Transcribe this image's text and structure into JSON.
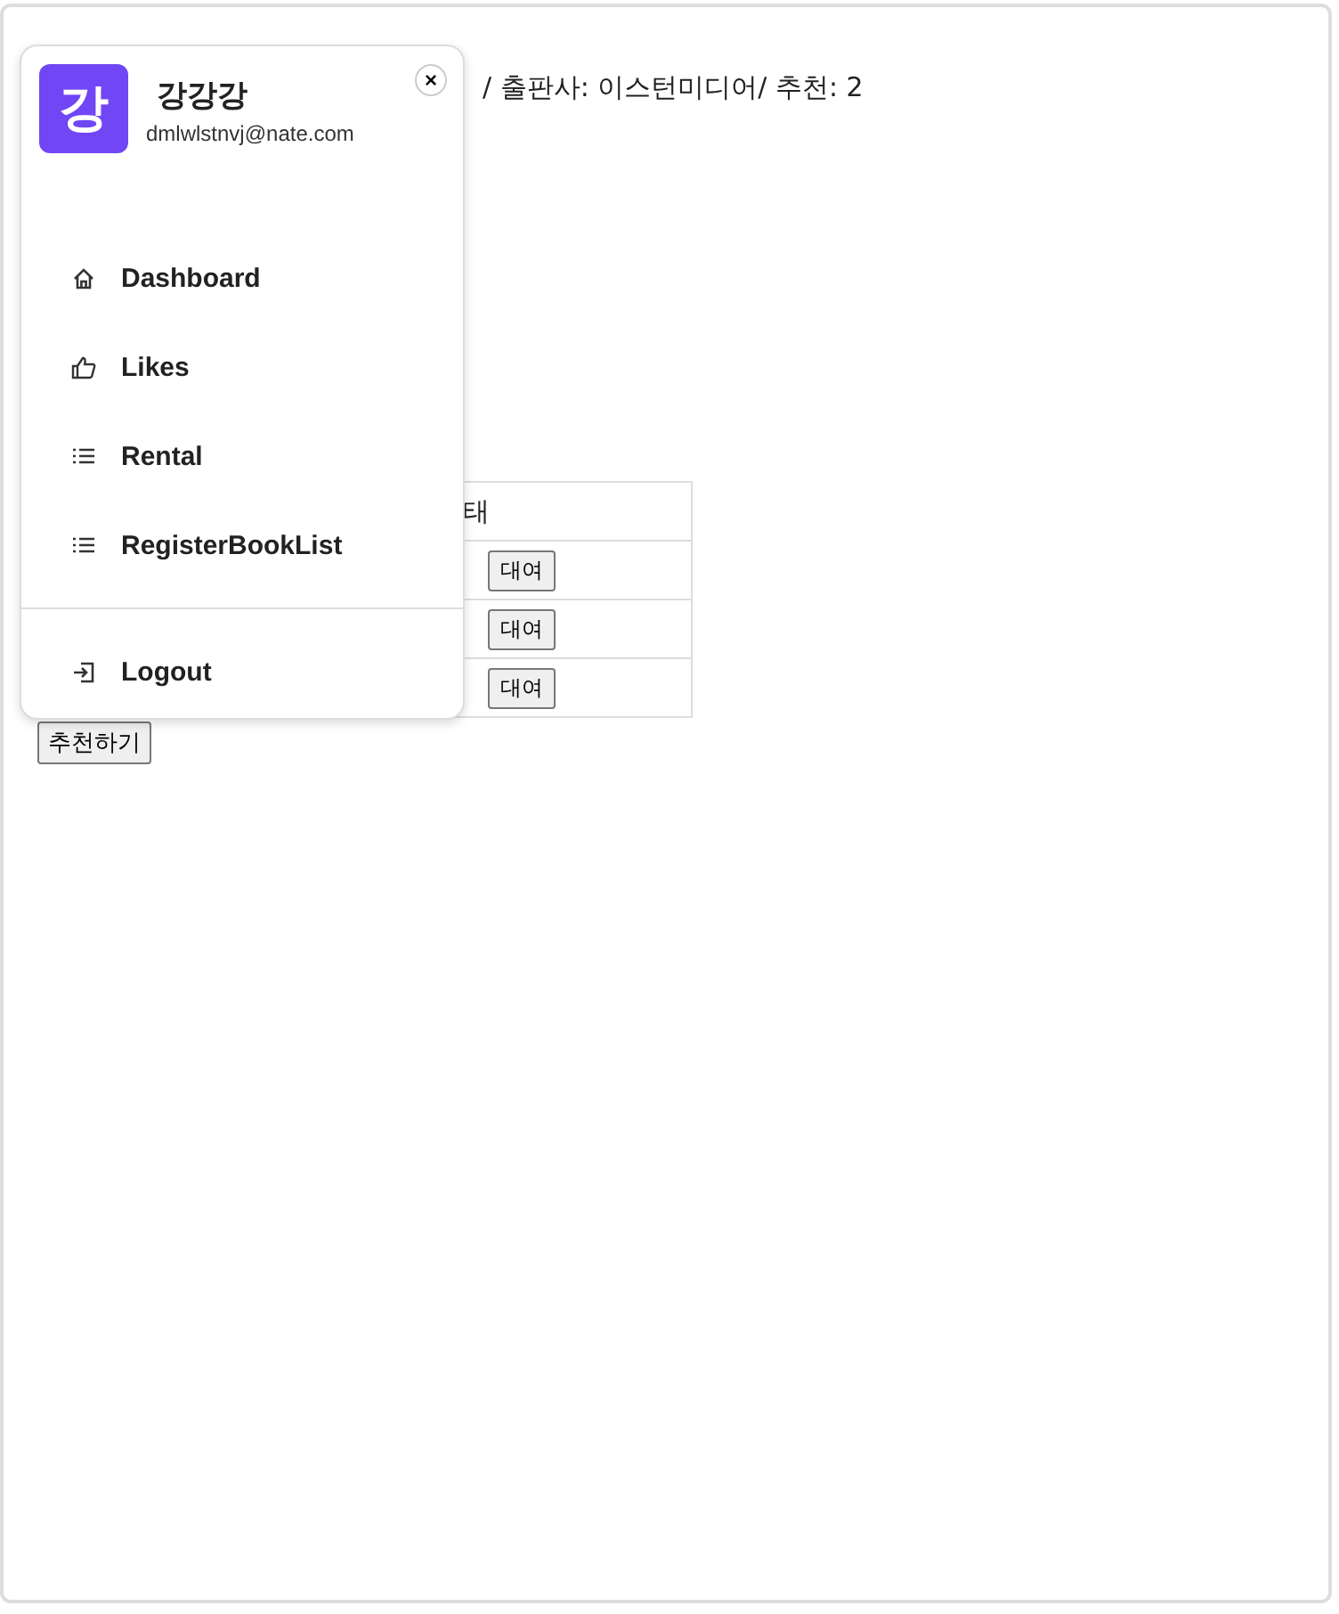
{
  "book_info": "/ 출판사: 이스턴미디어/ 추천: 2",
  "table": {
    "columns": [
      "태"
    ],
    "rows": [
      {
        "action": "대여"
      },
      {
        "action": "대여"
      },
      {
        "action": "대여"
      }
    ]
  },
  "recommend_button": "추천하기",
  "menu": {
    "avatar": "강",
    "name": "강강강",
    "email": "dmlwlstnvj@nate.com",
    "close": "×",
    "items": [
      {
        "label": "Dashboard",
        "kind": "home"
      },
      {
        "label": "Likes",
        "kind": "like"
      },
      {
        "label": "Rental",
        "kind": "list"
      },
      {
        "label": "RegisterBookList",
        "kind": "list"
      }
    ],
    "logout": "Logout"
  }
}
